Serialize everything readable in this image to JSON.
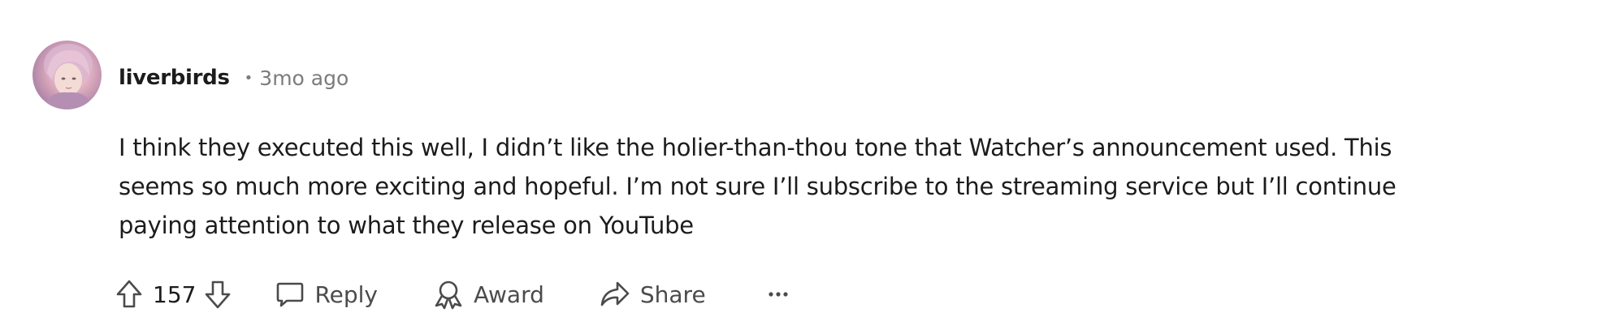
{
  "comment": {
    "username": "liverbirds",
    "separator": "•",
    "timestamp": "3mo ago",
    "body": "I think they executed this well, I didn’t like the holier-than-thou tone that Watcher’s announcement used. This\nseems so much more exciting and hopeful. I’m not sure I’ll subscribe to the streaming service but I’ll continue\npaying attention to what they release on YouTube"
  },
  "actions": {
    "vote_count": "157",
    "reply_label": "Reply",
    "award_label": "Award",
    "share_label": "Share",
    "more_label": "···"
  },
  "icons": {
    "upvote": "arrow-up-outline-icon",
    "downvote": "arrow-down-outline-icon",
    "reply": "speech-bubble-icon",
    "award": "award-ribbon-icon",
    "share": "share-arrow-icon",
    "more": "ellipsis-icon"
  },
  "colors": {
    "text": "#1c1c1c",
    "muted": "#7c7c7c",
    "action": "#4b4b4b"
  }
}
